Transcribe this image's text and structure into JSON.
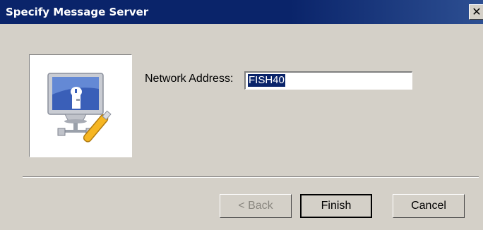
{
  "window": {
    "title": "Specify Message Server",
    "close_glyph": "✕",
    "title_bar_color": "#0a246a"
  },
  "icon": {
    "name": "network-computer-key-icon"
  },
  "form": {
    "network_address_label": "Network Address:",
    "network_address_value": "FISH40"
  },
  "buttons": {
    "back_label": "< Back",
    "finish_label": "Finish",
    "cancel_label": "Cancel"
  }
}
